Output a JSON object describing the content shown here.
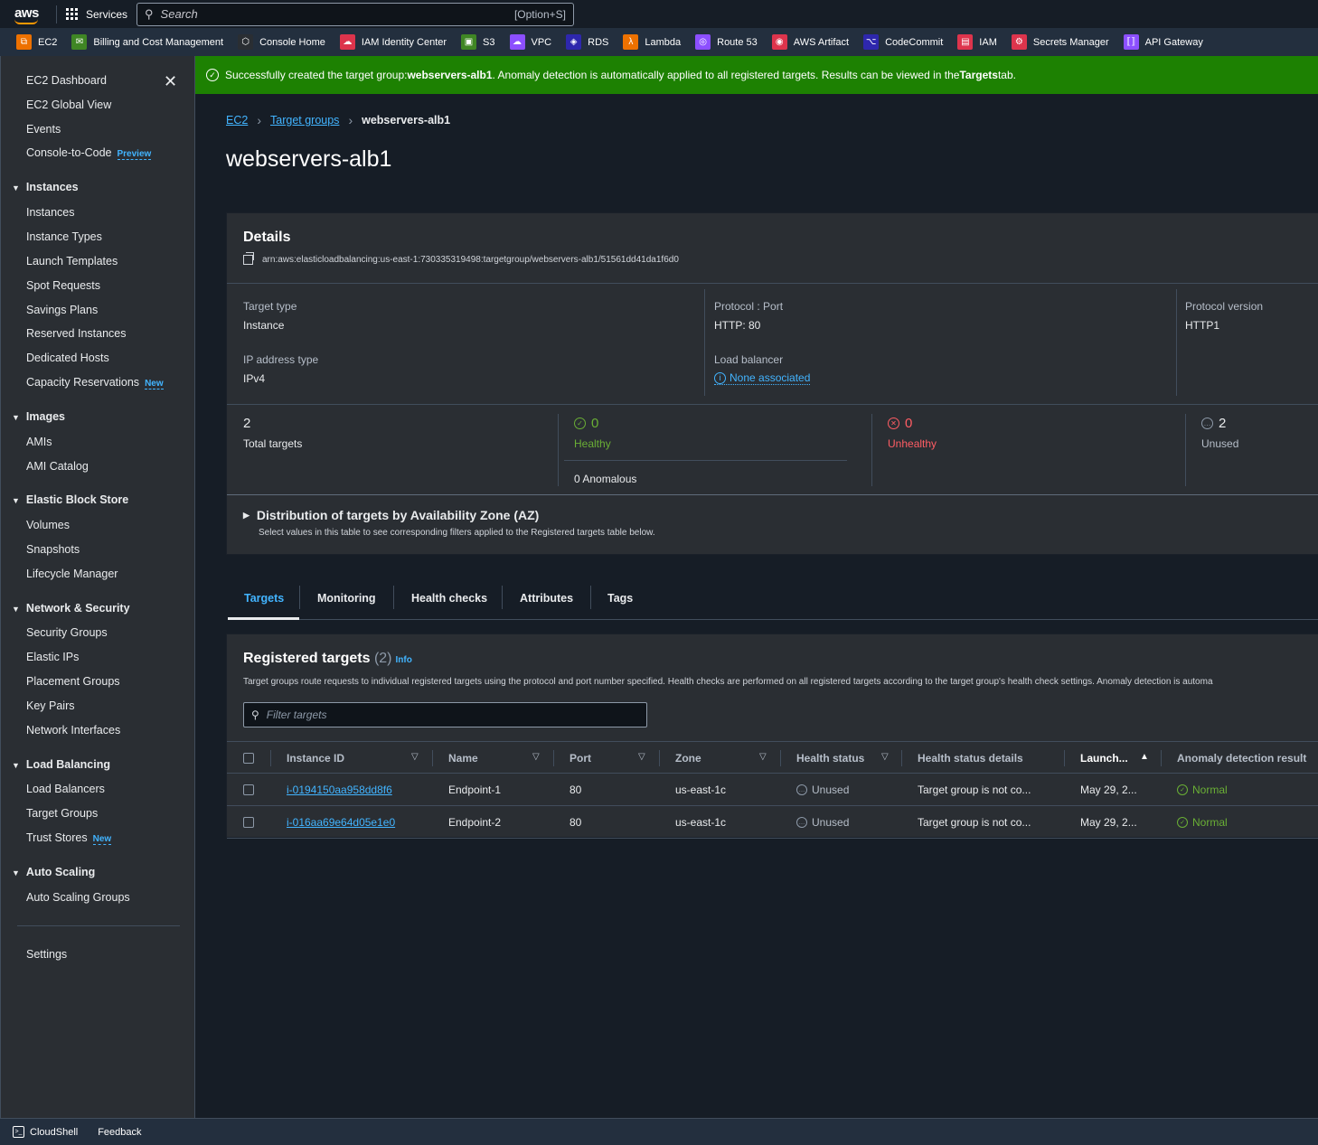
{
  "topnav": {
    "logo": "aws",
    "services_label": "Services",
    "search_placeholder": "Search",
    "search_shortcut": "[Option+S]"
  },
  "favorites": [
    {
      "label": "EC2",
      "icon": "ec2-icon",
      "color": "#ed7100",
      "glyph": "⧉"
    },
    {
      "label": "Billing and Cost Management",
      "icon": "billing-icon",
      "color": "#3f8624",
      "glyph": "✉"
    },
    {
      "label": "Console Home",
      "icon": "cube-icon",
      "color": "#2a2e33",
      "glyph": "⬡"
    },
    {
      "label": "IAM Identity Center",
      "icon": "iam-identity-center-icon",
      "color": "#dd344c",
      "glyph": "☁"
    },
    {
      "label": "S3",
      "icon": "s3-icon",
      "color": "#3f8624",
      "glyph": "▣"
    },
    {
      "label": "VPC",
      "icon": "vpc-icon",
      "color": "#8c4fff",
      "glyph": "☁"
    },
    {
      "label": "RDS",
      "icon": "rds-icon",
      "color": "#2e27ad",
      "glyph": "◈"
    },
    {
      "label": "Lambda",
      "icon": "lambda-icon",
      "color": "#ed7100",
      "glyph": "λ"
    },
    {
      "label": "Route 53",
      "icon": "route53-icon",
      "color": "#8c4fff",
      "glyph": "◎"
    },
    {
      "label": "AWS Artifact",
      "icon": "artifact-icon",
      "color": "#dd344c",
      "glyph": "◉"
    },
    {
      "label": "CodeCommit",
      "icon": "codecommit-icon",
      "color": "#2e27ad",
      "glyph": "⌥"
    },
    {
      "label": "IAM",
      "icon": "iam-icon",
      "color": "#dd344c",
      "glyph": "▤"
    },
    {
      "label": "Secrets Manager",
      "icon": "secrets-manager-icon",
      "color": "#dd344c",
      "glyph": "⚙"
    },
    {
      "label": "API Gateway",
      "icon": "api-gateway-icon",
      "color": "#8c4fff",
      "glyph": "⟦⟧"
    }
  ],
  "sidebar": {
    "top_items": [
      "EC2 Dashboard",
      "EC2 Global View",
      "Events",
      "Console-to-Code"
    ],
    "console_to_code_badge": "Preview",
    "sections": [
      {
        "title": "Instances",
        "items": [
          "Instances",
          "Instance Types",
          "Launch Templates",
          "Spot Requests",
          "Savings Plans",
          "Reserved Instances",
          "Dedicated Hosts",
          "Capacity Reservations"
        ]
      },
      {
        "title": "Images",
        "items": [
          "AMIs",
          "AMI Catalog"
        ]
      },
      {
        "title": "Elastic Block Store",
        "items": [
          "Volumes",
          "Snapshots",
          "Lifecycle Manager"
        ]
      },
      {
        "title": "Network & Security",
        "items": [
          "Security Groups",
          "Elastic IPs",
          "Placement Groups",
          "Key Pairs",
          "Network Interfaces"
        ]
      },
      {
        "title": "Load Balancing",
        "items": [
          "Load Balancers",
          "Target Groups",
          "Trust Stores"
        ]
      },
      {
        "title": "Auto Scaling",
        "items": [
          "Auto Scaling Groups"
        ]
      }
    ],
    "new_badge": "New",
    "settings": "Settings"
  },
  "flash": {
    "prefix": "Successfully created the target group: ",
    "name": "webservers-alb1",
    "middle": ". Anomaly detection is automatically applied to all registered targets. Results can be viewed in the ",
    "tab": "Targets",
    "suffix": " tab."
  },
  "breadcrumb": {
    "items": [
      "EC2",
      "Target groups"
    ],
    "current": "webservers-alb1"
  },
  "page_title": "webservers-alb1",
  "details": {
    "title": "Details",
    "arn": "arn:aws:elasticloadbalancing:us-east-1:730335319498:targetgroup/webservers-alb1/51561dd41da1f6d0",
    "target_type_label": "Target type",
    "target_type": "Instance",
    "protocol_port_label": "Protocol : Port",
    "protocol_port": "HTTP: 80",
    "protocol_version_label": "Protocol version",
    "protocol_version": "HTTP1",
    "ip_type_label": "IP address type",
    "ip_type": "IPv4",
    "lb_label": "Load balancer",
    "lb_value": "None associated",
    "total_targets": "2",
    "total_targets_label": "Total targets",
    "healthy": "0",
    "healthy_label": "Healthy",
    "anomalous": "0 Anomalous",
    "unhealthy": "0",
    "unhealthy_label": "Unhealthy",
    "unused": "2",
    "unused_label": "Unused",
    "distribution_title": "Distribution of targets by Availability Zone (AZ)",
    "distribution_sub": "Select values in this table to see corresponding filters applied to the Registered targets table below."
  },
  "tabs": [
    "Targets",
    "Monitoring",
    "Health checks",
    "Attributes",
    "Tags"
  ],
  "targets": {
    "title": "Registered targets",
    "count": "(2)",
    "info": "Info",
    "description": "Target groups route requests to individual registered targets using the protocol and port number specified. Health checks are performed on all registered targets according to the target group's health check settings. Anomaly detection is automa",
    "filter_placeholder": "Filter targets",
    "columns": [
      "Instance ID",
      "Name",
      "Port",
      "Zone",
      "Health status",
      "Health status details",
      "Launch...",
      "Anomaly detection result"
    ],
    "rows": [
      {
        "id": "i-0194150aa958dd8f6",
        "name": "Endpoint-1",
        "port": "80",
        "zone": "us-east-1c",
        "health": "Unused",
        "details": "Target group is not co...",
        "launch": "May 29, 2...",
        "anomaly": "Normal"
      },
      {
        "id": "i-016aa69e64d05e1e0",
        "name": "Endpoint-2",
        "port": "80",
        "zone": "us-east-1c",
        "health": "Unused",
        "details": "Target group is not co...",
        "launch": "May 29, 2...",
        "anomaly": "Normal"
      }
    ]
  },
  "footer": {
    "cloudshell": "CloudShell",
    "feedback": "Feedback"
  },
  "colors": {
    "success": "#1d8102",
    "link": "#42b4ff",
    "healthy": "#6aaf35",
    "unhealthy": "#ff5d64"
  }
}
